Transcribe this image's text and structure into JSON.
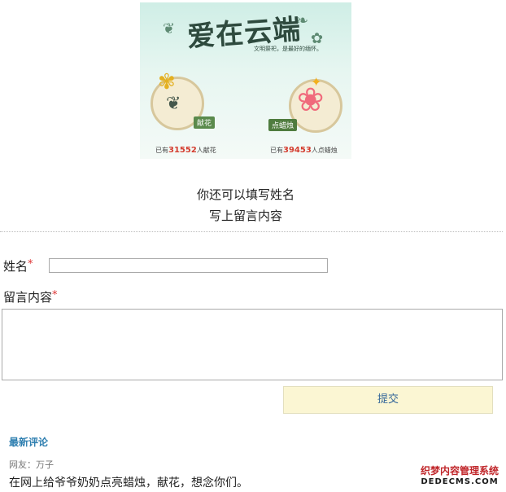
{
  "banner": {
    "title": "爱在云端",
    "subtitle": "文明祭祀，是最好的缅怀。",
    "offer_flower_label": "献花",
    "light_candle_label": "点蜡烛",
    "flower_count_prefix": "已有",
    "flower_count": "31552",
    "flower_count_suffix": "人献花",
    "candle_count_prefix": "已有",
    "candle_count": "39453",
    "candle_count_suffix": "人点蜡烛"
  },
  "intro": {
    "line1": "你还可以填写姓名",
    "line2": "写上留言内容"
  },
  "form": {
    "name_label": "姓名",
    "required_mark": "*",
    "name_value": "",
    "message_label": "留言内容",
    "message_value": "",
    "submit_label": "提交"
  },
  "comments": {
    "title": "最新评论",
    "items": [
      {
        "author": "网友：万子",
        "text": "在网上给爷爷奶奶点亮蜡烛，献花，想念你们。"
      }
    ]
  },
  "watermark": {
    "line1": "织梦内容管理系统",
    "line2": "DEDECMS.COM"
  },
  "colors": {
    "accent_blue": "#2f7fb0",
    "required_red": "#d33",
    "submit_bg": "#fbf6d3",
    "count_red": "#d43d2f"
  }
}
